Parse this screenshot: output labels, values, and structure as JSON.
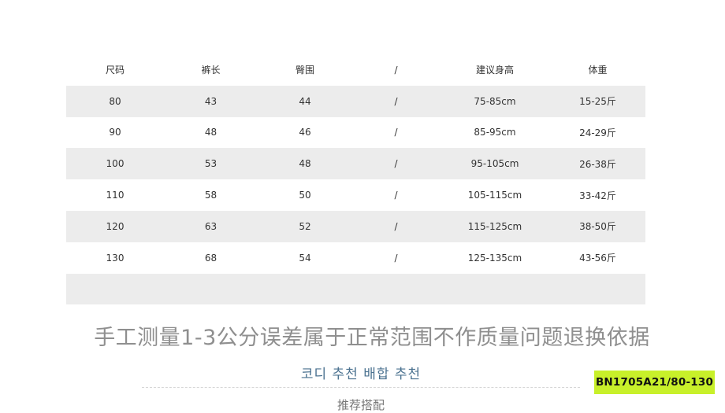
{
  "size_table": {
    "headers": [
      "尺码",
      "裤长",
      "臀围",
      "/",
      "建议身高",
      "体重"
    ],
    "rows": [
      [
        "80",
        "43",
        "44",
        "/",
        "75-85cm",
        "15-25斤"
      ],
      [
        "90",
        "48",
        "46",
        "/",
        "85-95cm",
        "24-29斤"
      ],
      [
        "100",
        "53",
        "48",
        "/",
        "95-105cm",
        "26-38斤"
      ],
      [
        "110",
        "58",
        "50",
        "/",
        "105-115cm",
        "33-42斤"
      ],
      [
        "120",
        "63",
        "52",
        "/",
        "115-125cm",
        "38-50斤"
      ],
      [
        "130",
        "68",
        "54",
        "/",
        "125-135cm",
        "43-56斤"
      ],
      [
        "",
        "",
        "",
        "",
        "",
        ""
      ]
    ]
  },
  "note": "手工测量1-3公分误差属于正常范围不作质量问题退换依据",
  "section": {
    "korean_title": "코디 추천 배합 추천",
    "chinese_title": "推荐搭配"
  },
  "sku_badge": "BN1705A21/80-130",
  "colors": {
    "row_shade": "#ececec",
    "badge_bg": "#c8f02a",
    "korean_text": "#4b7290"
  }
}
